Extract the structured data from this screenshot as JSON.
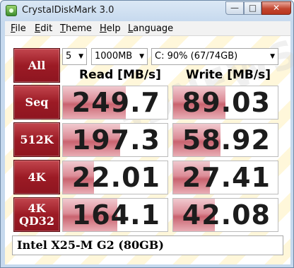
{
  "window": {
    "title": "CrystalDiskMark 3.0"
  },
  "controls": {
    "minimize": "—",
    "maximize": "□",
    "close": "✕"
  },
  "menu": [
    {
      "mnemonic": "F",
      "rest": "ile"
    },
    {
      "mnemonic": "E",
      "rest": "dit"
    },
    {
      "mnemonic": "T",
      "rest": "heme"
    },
    {
      "mnemonic": "H",
      "rest": "elp"
    },
    {
      "mnemonic": "L",
      "rest": "anguage"
    }
  ],
  "buttons": {
    "all": "All",
    "seq": "Seq",
    "k512": "512K",
    "k4": "4K",
    "k4qd32": "4K\nQD32"
  },
  "settings": {
    "count": "5",
    "size": "1000MB",
    "drive": "C: 90% (67/74GB)"
  },
  "headers": {
    "read": "Read [MB/s]",
    "write": "Write [MB/s]"
  },
  "results": {
    "seq": {
      "read": "249.7",
      "write": "89.03",
      "read_fill": 0.6,
      "write_fill": 0.5
    },
    "k512": {
      "read": "197.3",
      "write": "58.92",
      "read_fill": 0.55,
      "write_fill": 0.45
    },
    "k4": {
      "read": "22.01",
      "write": "27.41",
      "read_fill": 0.3,
      "write_fill": 0.35
    },
    "k4qd32": {
      "read": "164.1",
      "write": "42.08",
      "read_fill": 0.52,
      "write_fill": 0.4
    }
  },
  "watermark": "3DNEWS.RU",
  "comment": "Intel X25-M G2 (80GB)",
  "colors": {
    "accent": "#9c1b25",
    "bar": "#c9636f"
  }
}
